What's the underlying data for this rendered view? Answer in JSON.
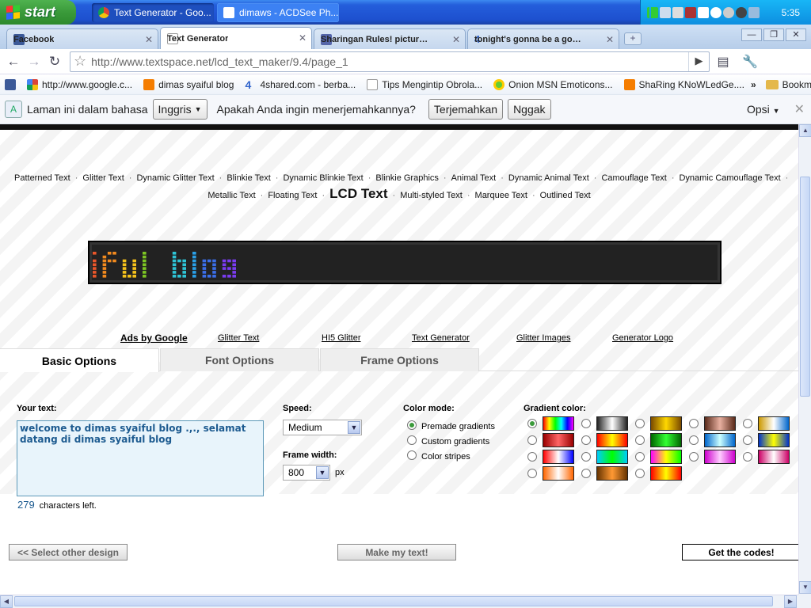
{
  "taskbar": {
    "start_label": "start",
    "buttons": [
      {
        "label": "Text Generator - Goo..."
      },
      {
        "label": "dimaws - ACDSee Ph..."
      }
    ],
    "clock": "5:35"
  },
  "browser_tabs": [
    {
      "label": "Facebook"
    },
    {
      "label": "Text Generator"
    },
    {
      "label": "Sharingan Rules! picture b..."
    },
    {
      "label": "tonight's gonna be a good ..."
    }
  ],
  "address_bar": {
    "url": "http://www.textspace.net/lcd_text_maker/9.4/page_1"
  },
  "bookmarks": [
    {
      "label": "http://www.google.c..."
    },
    {
      "label": "dimas syaiful blog"
    },
    {
      "label": "4shared.com - berba..."
    },
    {
      "label": "Tips Mengintip Obrola..."
    },
    {
      "label": "Onion MSN Emoticons..."
    },
    {
      "label": "ShaRing KNoWLedGe...."
    }
  ],
  "bookmarks_more": "»",
  "bookmarks_other": "Bookmark lain",
  "translate_bar": {
    "prefix": "Laman ini dalam bahasa",
    "language": "Inggris",
    "question": "Apakah Anda ingin menerjemahkannya?",
    "translate_btn": "Terjemahkan",
    "no_btn": "Nggak",
    "options": "Opsi"
  },
  "style_links": {
    "row1": [
      "Patterned Text",
      "Glitter Text",
      "Dynamic Glitter Text",
      "Blinkie Text",
      "Dynamic Blinkie Text",
      "Blinkie Graphics",
      "Animal Text",
      "Dynamic Animal Text",
      "Camouflage Text",
      "Dynamic Camouflage Text"
    ],
    "row2_before": [
      "Metallic Text",
      "Floating Text"
    ],
    "current": "LCD Text",
    "row2_after": [
      "Multi-styled Text",
      "Marquee Text",
      "Outlined Text"
    ]
  },
  "lcd_preview": {
    "text": "iful blog"
  },
  "ad_links": {
    "heading": "Ads by Google",
    "links": [
      "Glitter Text",
      "HI5 Glitter",
      "Text Generator",
      "Glitter Images",
      "Generator Logo"
    ]
  },
  "options": {
    "tabs": [
      "Basic Options",
      "Font Options",
      "Frame Options"
    ],
    "your_text_label": "Your text:",
    "your_text_value": "welcome to dimas syaiful blog .,., selamat datang di dimas syaiful blog",
    "chars_left_count": "279",
    "chars_left_label": "characters left.",
    "speed_label": "Speed:",
    "speed_value": "Medium",
    "frame_width_label": "Frame width:",
    "frame_width_value": "800",
    "frame_width_unit": "px",
    "color_mode_label": "Color mode:",
    "color_modes": [
      "Premade gradients",
      "Custom gradients",
      "Color stripes"
    ],
    "gradient_label": "Gradient color:"
  },
  "gradients": [
    "linear-gradient(90deg,#f00,#ff0,#0f0,#0ff,#00f,#f0f)",
    "linear-gradient(90deg,#222,#fff,#222)",
    "linear-gradient(90deg,#7a4a00,#ffd700,#7a4a00)",
    "linear-gradient(90deg,#5a2a1a,#e8b0a0,#5a2a1a)",
    "linear-gradient(90deg,#c90,#fff,#06c)",
    "linear-gradient(90deg,#900,#f66,#900)",
    "linear-gradient(90deg,#f00,#ff0,#f00)",
    "linear-gradient(90deg,#060,#3f3,#060)",
    "linear-gradient(90deg,#06c,#cff,#06c)",
    "linear-gradient(90deg,#03c,#ff0,#03c)",
    "linear-gradient(90deg,#f00,#fff,#00f)",
    "linear-gradient(90deg,#0cf,#0f0,#0cf)",
    "linear-gradient(90deg,#f0f,#ff0,#0f0)",
    "linear-gradient(90deg,#c0c,#fcf,#c0c)",
    "linear-gradient(90deg,#c06,#fff,#c06)",
    "linear-gradient(90deg,#f60,#fff,#f60)",
    "linear-gradient(90deg,#630,#f93,#630)",
    "linear-gradient(90deg,#f00,#ff0,#f00)"
  ],
  "footer_buttons": {
    "select_other": "<< Select other design",
    "make_text": "Make my text!",
    "get_codes": "Get the codes!"
  }
}
